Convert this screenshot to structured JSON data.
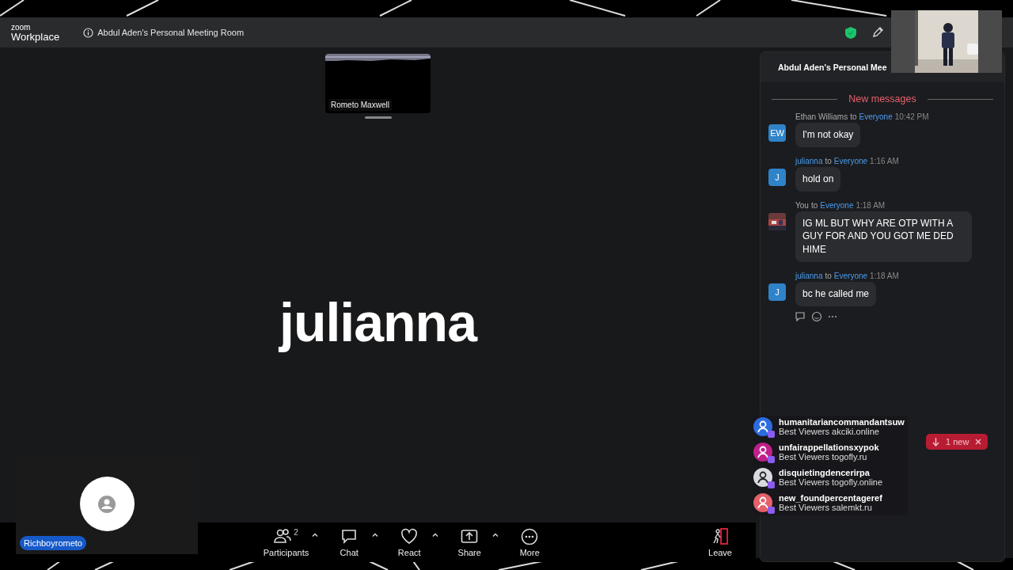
{
  "window": {
    "logo_top": "zoom",
    "logo_bottom": "Workplace",
    "title": "Abdul Aden's Personal Meeting Room"
  },
  "stage": {
    "thumbnail": {
      "name": "Rometo Maxwell"
    },
    "active_speaker": "julianna",
    "self_tile": {
      "name": "Richboyrometo"
    }
  },
  "toolbar": {
    "items": [
      {
        "kind": "participants",
        "label": "Participants",
        "count": "2",
        "caret": true
      },
      {
        "kind": "chat",
        "label": "Chat",
        "caret": true
      },
      {
        "kind": "react",
        "label": "React",
        "caret": true
      },
      {
        "kind": "share",
        "label": "Share",
        "caret": true
      },
      {
        "kind": "more",
        "label": "More",
        "caret": false
      }
    ],
    "leave": {
      "label": "Leave"
    }
  },
  "chat": {
    "header": "Abdul Aden's Personal Mee",
    "divider": "New messages",
    "messages": [
      {
        "kind": "initials",
        "initials": "EW",
        "sender": "Ethan Williams",
        "sender_highlighted": false,
        "connector": "to",
        "recipient": "Everyone",
        "time": "10:42 PM",
        "text": "I'm not okay"
      },
      {
        "kind": "initials",
        "initials": "J",
        "sender": "julianna",
        "sender_highlighted": true,
        "connector": "to",
        "recipient": "Everyone",
        "time": "1:16 AM",
        "text": "hold on"
      },
      {
        "kind": "picture",
        "sender": "You",
        "sender_highlighted": false,
        "connector": "to",
        "recipient": "Everyone",
        "time": "1:18 AM",
        "text": "IG ML BUT WHY ARE OTP WITH A GUY FOR AND YOU GOT ME DED HIME"
      },
      {
        "kind": "initials",
        "initials": "J",
        "sender": "julianna",
        "sender_highlighted": true,
        "connector": "to",
        "recipient": "Everyone",
        "time": "1:18 AM",
        "text": "bc he called me"
      }
    ],
    "toast": {
      "label": "1 new"
    }
  },
  "notifications": [
    {
      "name": "humanitariancommandantsuw",
      "text": "Best Viewers akciki.online",
      "color": "#2d6cdf"
    },
    {
      "name": "unfairappellationsxypok",
      "text": "Best Viewers togofly.ru",
      "color": "#c0208a"
    },
    {
      "name": "disquietingdencerirpa",
      "text": "Best Viewers togofly.online",
      "color": "#d9d9e0"
    },
    {
      "name": "new_foundpercentageref",
      "text": "Best Viewers salemkt.ru",
      "color": "#e5606a"
    }
  ]
}
